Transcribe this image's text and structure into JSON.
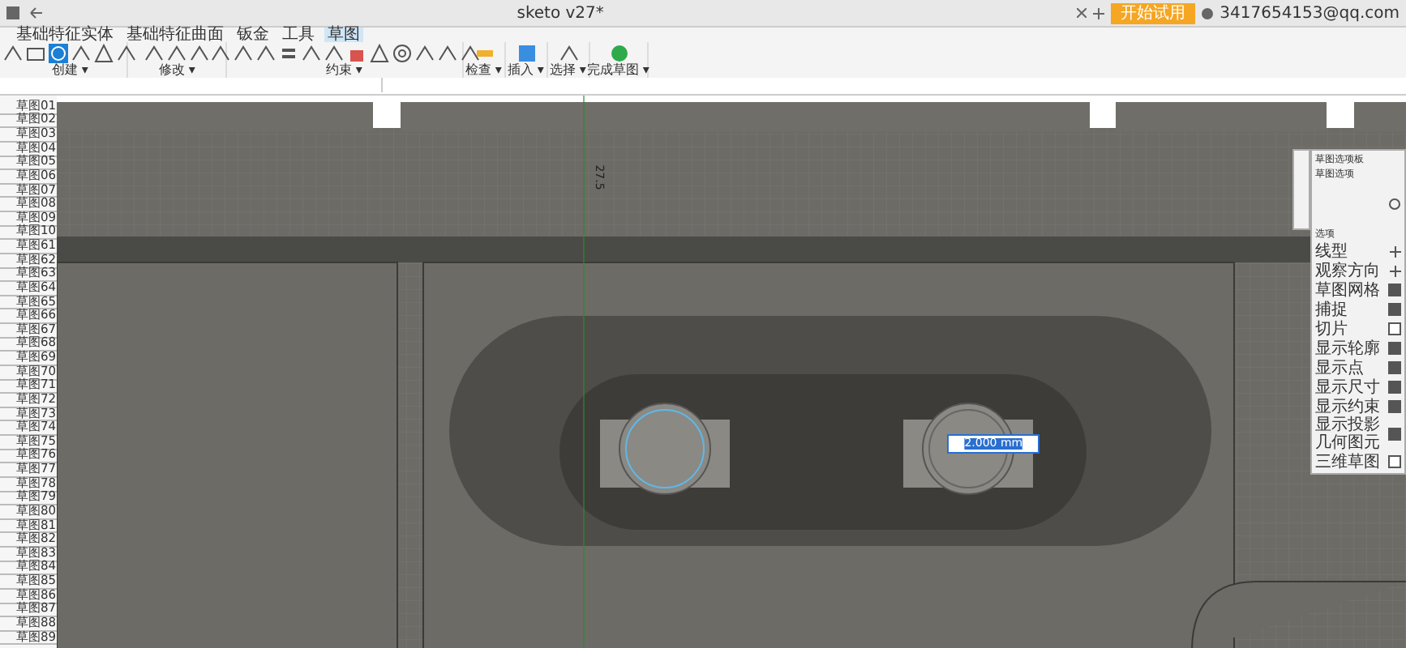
{
  "window": {
    "title": "sketo v27*",
    "account": "3417654153@qq.com",
    "upgrade": "开始试用"
  },
  "ribbon": {
    "tabs": [
      {
        "label": "基础特征实体",
        "selected": false
      },
      {
        "label": "基础特征曲面",
        "selected": false
      },
      {
        "label": "钣金",
        "selected": false
      },
      {
        "label": "工具",
        "selected": false
      },
      {
        "label": "草图",
        "selected": true
      }
    ],
    "groups": [
      {
        "label": "创建 ▾"
      },
      {
        "label": "修改 ▾"
      },
      {
        "label": "约束 ▾"
      },
      {
        "label": "检查 ▾"
      },
      {
        "label": "插入 ▾"
      },
      {
        "label": "选择 ▾"
      },
      {
        "label": "完成草图 ▾"
      }
    ]
  },
  "browser": {
    "items": [
      "草图01",
      "草图02",
      "草图03",
      "草图04",
      "草图05",
      "草图06",
      "草图07",
      "草图08",
      "草图09",
      "草图10",
      "草图61",
      "草图62",
      "草图63",
      "草图64",
      "草图65",
      "草图66",
      "草图67",
      "草图68",
      "草图69",
      "草图70",
      "草图71",
      "草图72",
      "草图73",
      "草图74",
      "草图75",
      "草图76",
      "草图77",
      "草图78",
      "草图79",
      "草图80",
      "草图81",
      "草图82",
      "草图83",
      "草图84",
      "草图85",
      "草图86",
      "草图87",
      "草图88",
      "草图89"
    ]
  },
  "canvas": {
    "dimension": "2.000 mm",
    "axis_label": "27.5"
  },
  "palette": {
    "title": "草图选项板",
    "section_1": "草图选项",
    "section_2": "选项",
    "options": [
      {
        "label": "线型",
        "kind": "icon"
      },
      {
        "label": "观察方向",
        "kind": "icon"
      },
      {
        "label": "草图网格",
        "kind": "check",
        "checked": true
      },
      {
        "label": "捕捉",
        "kind": "check",
        "checked": true
      },
      {
        "label": "切片",
        "kind": "check",
        "checked": false
      },
      {
        "label": "显示轮廓",
        "kind": "check",
        "checked": true
      },
      {
        "label": "显示点",
        "kind": "check",
        "checked": true
      },
      {
        "label": "显示尺寸",
        "kind": "check",
        "checked": true
      },
      {
        "label": "显示约束",
        "kind": "check",
        "checked": true
      },
      {
        "label": "显示投影几何图元",
        "kind": "check",
        "checked": true
      },
      {
        "label": "三维草图",
        "kind": "check",
        "checked": false
      }
    ]
  }
}
